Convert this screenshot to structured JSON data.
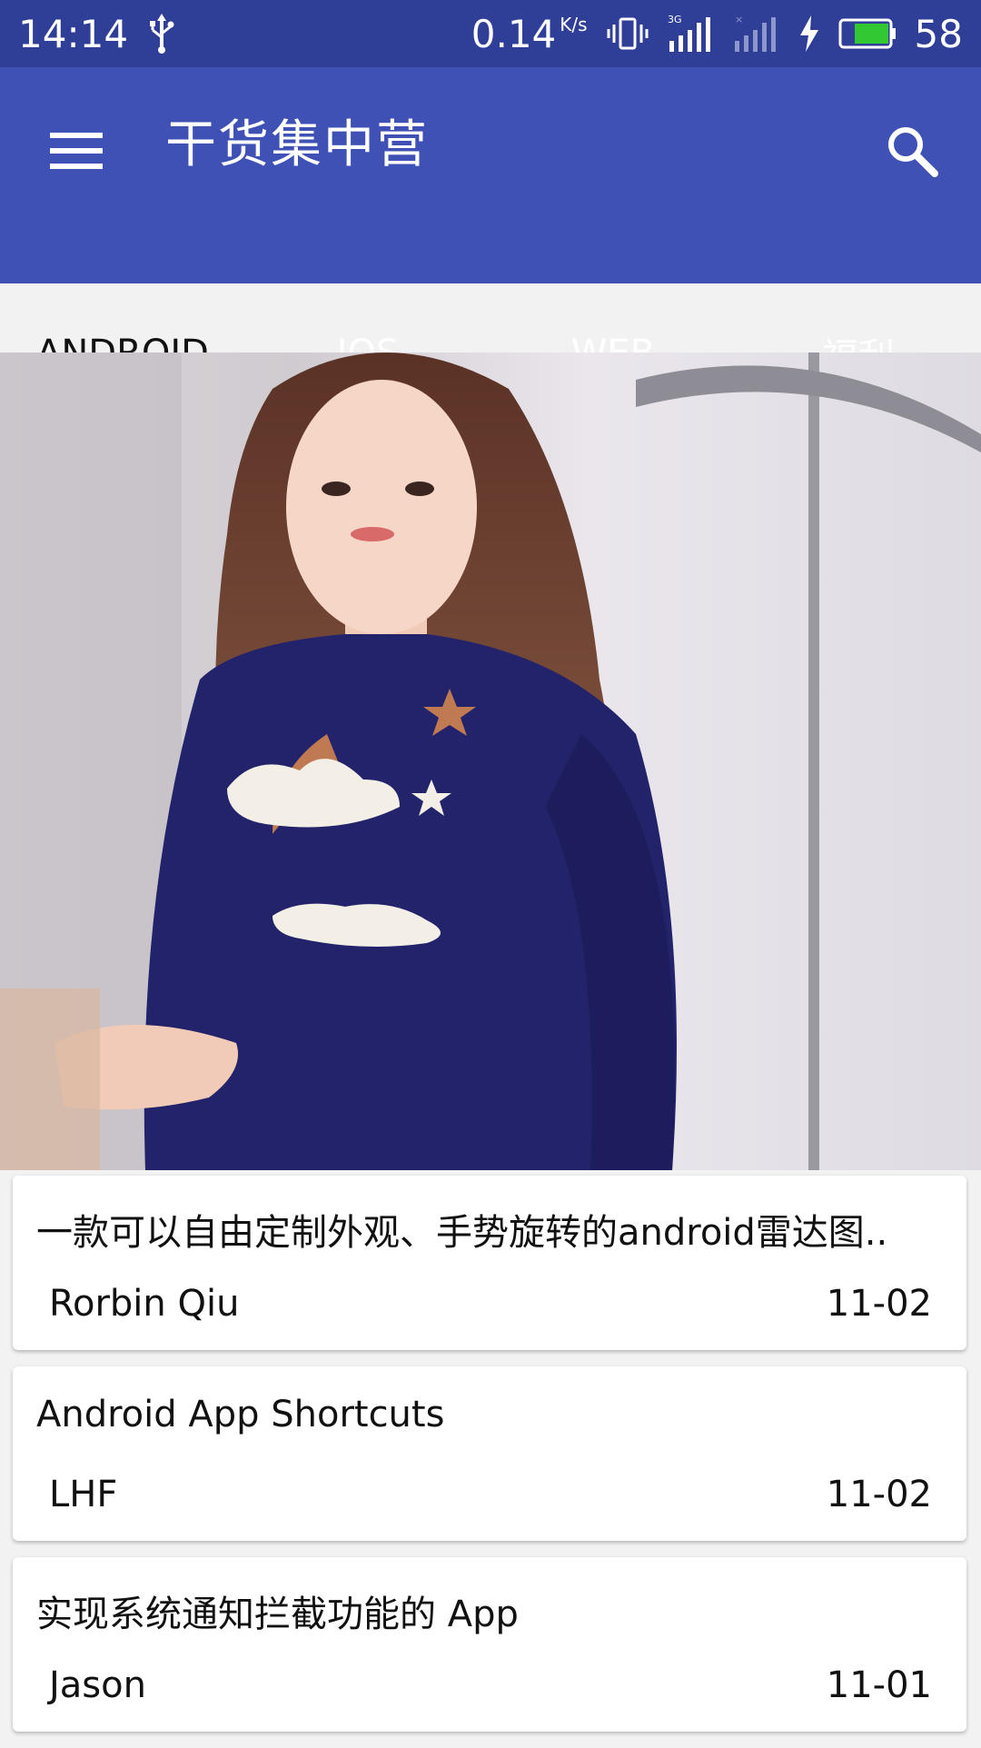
{
  "status_bar": {
    "time": "14:14",
    "net_speed": "0.14",
    "net_speed_unit": "K/s",
    "battery": "58",
    "network_type": "3G",
    "icons": [
      "usb-icon",
      "vibrate-icon",
      "signal-icon",
      "signal-weak-icon",
      "charging-icon",
      "battery-icon"
    ]
  },
  "toolbar": {
    "title": "干货集中营",
    "menu_icon": "menu-icon",
    "search_icon": "search-icon",
    "background": "#3f51b5"
  },
  "tabs": [
    {
      "label": "ANDROID",
      "active": true
    },
    {
      "label": "IOS",
      "active": false
    },
    {
      "label": "WEB",
      "active": false
    },
    {
      "label": "福利",
      "active": false
    }
  ],
  "colors": {
    "status_bar": "#2f3f98",
    "primary": "#3f51b5",
    "accent": "#ff4081"
  },
  "articles": [
    {
      "title": "一款可以自由定制外观、手势旋转的android雷达图..",
      "author": "Rorbin Qiu",
      "date": "11-02"
    },
    {
      "title": "Android App Shortcuts",
      "author": "LHF",
      "date": "11-02"
    },
    {
      "title": "实现系统通知拦截功能的 App",
      "author": "Jason",
      "date": "11-01"
    }
  ]
}
